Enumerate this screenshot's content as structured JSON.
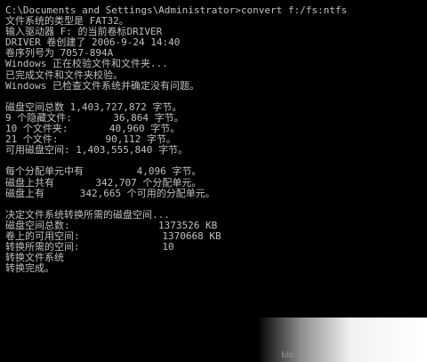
{
  "console": {
    "lines": [
      "C:\\Documents and Settings\\Administrator>convert f:/fs:ntfs",
      "文件系统的类型是 FAT32。",
      "输入驱动器 F: 的当前卷标DRIVER",
      "DRIVER 卷创建了 2006-9-24 14:40",
      "卷序列号为 7057-894A",
      "Windows 正在校验文件和文件夹...",
      "已完成文件和文件夹校验。",
      "Windows 已检查文件系统并确定没有问题。",
      "",
      "磁盘空间总数 1,403,727,872 字节。",
      "9 个隐藏文件:       36,864 字节。",
      "10 个文件夹:       40,960 字节。",
      "21 个文件:        90,112 字节。",
      "可用磁盘空间: 1,403,555,840 字节。",
      "",
      "每个分配单元中有         4,096 字节。",
      "磁盘上共有       342,707 个分配单元。",
      "磁盘上有      342,665 个可用的分配单元。",
      "",
      "决定文件系统转换所需的磁盘空间...",
      "磁盘空间总数:               1373526 KB",
      "卷上的可用空间:              1370668 KB",
      "转换所需的空间:              10",
      "转换文件系统",
      "转换完成。"
    ]
  },
  "watermark": {
    "text": "blo"
  },
  "colors": {
    "background": "#000000",
    "text": "#c0c0c0"
  }
}
